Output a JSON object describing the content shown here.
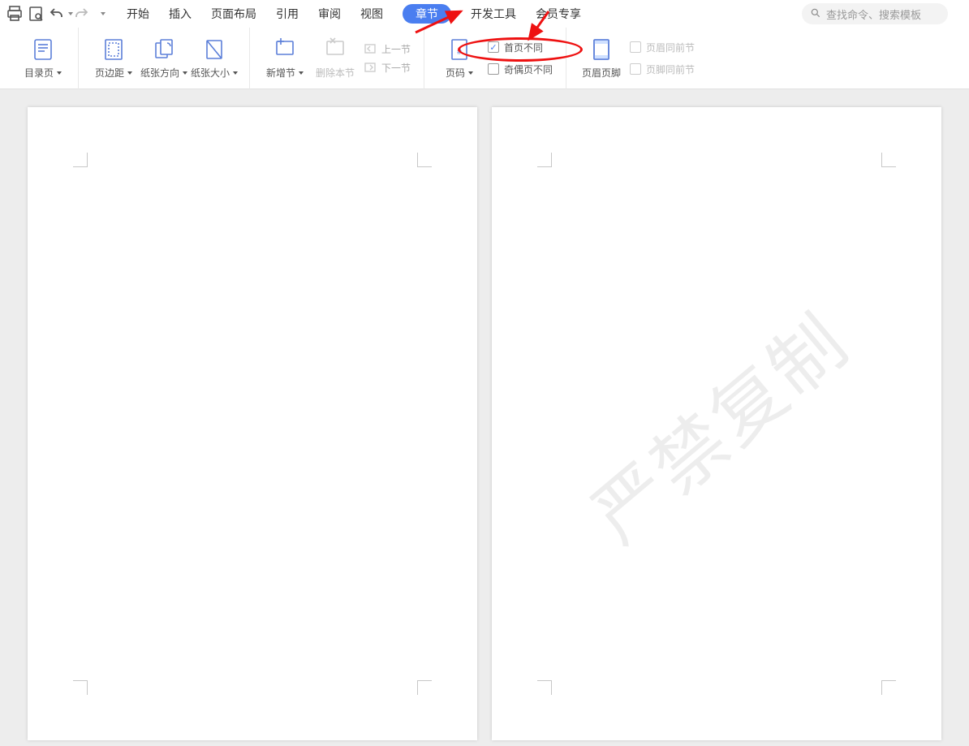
{
  "qat": {
    "print": "打印",
    "preview": "打印预览",
    "undo": "撤销",
    "redo": "恢复"
  },
  "tabs": {
    "items": [
      {
        "label": "开始"
      },
      {
        "label": "插入"
      },
      {
        "label": "页面布局"
      },
      {
        "label": "引用"
      },
      {
        "label": "审阅"
      },
      {
        "label": "视图"
      },
      {
        "label": "章节",
        "active": true
      },
      {
        "label": "开发工具"
      },
      {
        "label": "会员专享"
      }
    ]
  },
  "search": {
    "placeholder": "查找命令、搜索模板"
  },
  "ribbon": {
    "toc": {
      "label": "目录页"
    },
    "margin": {
      "label": "页边距"
    },
    "orient": {
      "label": "纸张方向"
    },
    "size": {
      "label": "纸张大小"
    },
    "newsec": {
      "label": "新增节"
    },
    "delsec": {
      "label": "删除本节"
    },
    "prevsec": {
      "label": "上一节"
    },
    "nextsec": {
      "label": "下一节"
    },
    "pagenum": {
      "label": "页码"
    },
    "hf": {
      "label": "页眉页脚"
    },
    "chk_first": {
      "label": "首页不同"
    },
    "chk_oddeven": {
      "label": "奇偶页不同"
    },
    "chk_hdr_same": {
      "label": "页眉同前节"
    },
    "chk_ftr_same": {
      "label": "页脚同前节"
    }
  },
  "watermark": {
    "text": "严禁复制"
  }
}
